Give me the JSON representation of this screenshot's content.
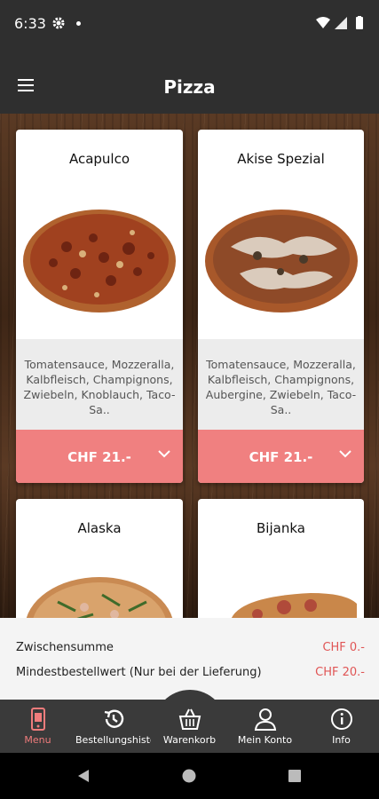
{
  "status_bar": {
    "time": "6:33"
  },
  "app_bar": {
    "title": "Pizza"
  },
  "pizzas": [
    {
      "name": "Acapulco",
      "description": "Tomatensauce, Mozzeralla, Kalbfleisch, Champignons, Zwiebeln, Knoblauch, Taco-Sa..",
      "price": "CHF 21.-"
    },
    {
      "name": "Akise Spezial",
      "description": "Tomatensauce, Mozzeralla, Kalbfleisch, Champignons, Aubergine, Zwiebeln, Taco-Sa..",
      "price": "CHF 21.-"
    },
    {
      "name": "Alaska",
      "description": "",
      "price": ""
    },
    {
      "name": "Bijanka",
      "description": "",
      "price": ""
    }
  ],
  "summary": {
    "subtotal_label": "Zwischensumme",
    "subtotal_value": "CHF 0.-",
    "minimum_label": "Mindestbestellwert (Nur bei der Lieferung)",
    "minimum_value": "CHF 20.-"
  },
  "bottom_nav": [
    {
      "label": "Menu",
      "icon": "menu-phone-icon",
      "active": true
    },
    {
      "label": "Bestellungshisto-",
      "icon": "history-icon",
      "active": false
    },
    {
      "label": "Warenkorb",
      "icon": "basket-icon",
      "active": false
    },
    {
      "label": "Mein Konto",
      "icon": "person-icon",
      "active": false
    },
    {
      "label": "Info",
      "icon": "info-icon",
      "active": false
    }
  ],
  "colors": {
    "accent": "#f08080",
    "active_nav": "#f07c7c",
    "bar": "#2f2f2f",
    "nav_bg": "#3a3a3a",
    "price_red": "#e05555"
  }
}
